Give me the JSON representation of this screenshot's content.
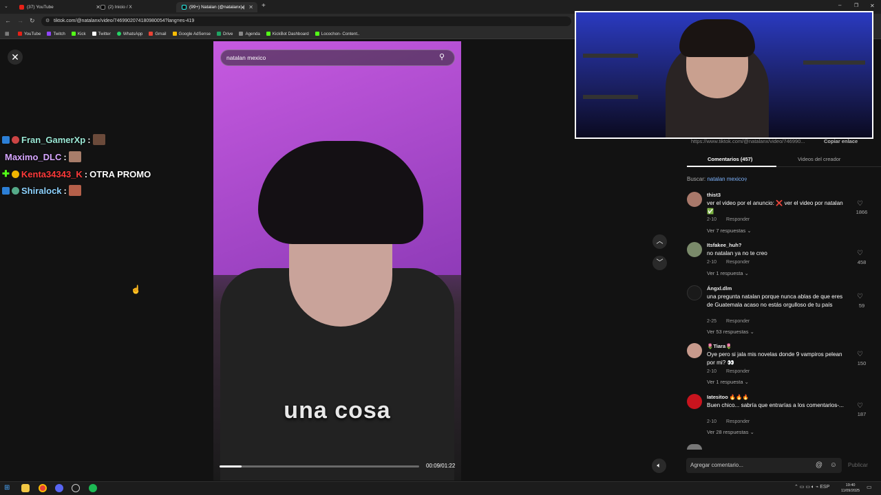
{
  "browser": {
    "tabs": [
      {
        "label": "(37) YouTube",
        "color": "#e62117"
      },
      {
        "label": "(2) Inicio / X",
        "color": "#000000"
      },
      {
        "label": "(99+) Natalan (@natalanx) |",
        "color": "#010101"
      }
    ],
    "url": "tiktok.com/@natalanx/video/7469902074180980054?lang=es-419",
    "bookmarks": [
      {
        "label": "YouTube",
        "color": "#e62117"
      },
      {
        "label": "Twitch",
        "color": "#9146ff"
      },
      {
        "label": "Kick",
        "color": "#53fc18"
      },
      {
        "label": "Twitter",
        "color": "#ffffff"
      },
      {
        "label": "WhatsApp",
        "color": "#25d366"
      },
      {
        "label": "Gmail",
        "color": "#ea4335"
      },
      {
        "label": "Google AdSense",
        "color": "#fbbc04"
      },
      {
        "label": "Drive",
        "color": "#1fa463"
      },
      {
        "label": "Agenda",
        "color": "#888888"
      },
      {
        "label": "KickBot Dashboard",
        "color": "#53fc18"
      },
      {
        "label": "Locochon- Content..",
        "color": "#53fc18"
      }
    ]
  },
  "chat": [
    {
      "user": "Fran_GamerXp",
      "color": "#9be8d5",
      "message": ""
    },
    {
      "user": "Maximo_DLC",
      "color": "#d7a6ff",
      "message": ""
    },
    {
      "user": "Kenta34343_K",
      "color": "#ff3b3b",
      "message": "OTRA PROMO"
    },
    {
      "user": "Shiralock",
      "color": "#8ed3ff",
      "message": ""
    }
  ],
  "video": {
    "search_value": "natalan mexico",
    "subtitle": "una cosa",
    "time": "00:09/01:22",
    "progress": 0.11
  },
  "panel": {
    "link": "https://www.tiktok.com/@natalanx/video/746990...",
    "copy_link": "Copiar enlace",
    "tab_comments": "Comentarios (457)",
    "tab_creator": "Videos del creador",
    "search_prefix": "Buscar:",
    "search_term": "natalan mexico",
    "comments": [
      {
        "user": "thist3",
        "text": "ver el video por el anuncio: ❌ ver el video por natalan ✅",
        "date": "2-10",
        "reply": "Responder",
        "replies": "Ver 7 respuestas",
        "likes": "1866",
        "avatar": "#a8786a"
      },
      {
        "user": "Itsfakee_huh?",
        "text": "no natalan ya no te creo",
        "date": "2-10",
        "reply": "Responder",
        "replies": "Ver 1 respuesta",
        "likes": "458",
        "avatar": "#7a8a6a"
      },
      {
        "user": "Ángxl.dlm",
        "text": "una pregunta natalan porque nunca ablas de que eres de Guatemala acaso no estás orgulloso de tu país",
        "date": "2-25",
        "reply": "Responder",
        "replies": "Ver 53 respuestas",
        "likes": "59",
        "avatar": "#1a1a1a"
      },
      {
        "user": "🌷Tiara🌷",
        "text": "Oye pero si jala mis novelas donde 9 vampiros pelean por mi? 👀",
        "date": "2-10",
        "reply": "Responder",
        "replies": "Ver 1 respuesta",
        "likes": "150",
        "avatar": "#c79a8c"
      },
      {
        "user": "Iatesitoo 🔥🔥🔥",
        "text": "Buen chico... sabría que entrarías a los comentarios-...",
        "date": "2-10",
        "reply": "Responder",
        "replies": "Ver 28 respuestas",
        "likes": "187",
        "avatar": "#c8141e"
      }
    ],
    "comment_placeholder": "Agregar comentario...",
    "publish": "Publicar"
  },
  "taskbar": {
    "time": "19:40",
    "date": "11/09/2025",
    "lang": "ESP"
  }
}
